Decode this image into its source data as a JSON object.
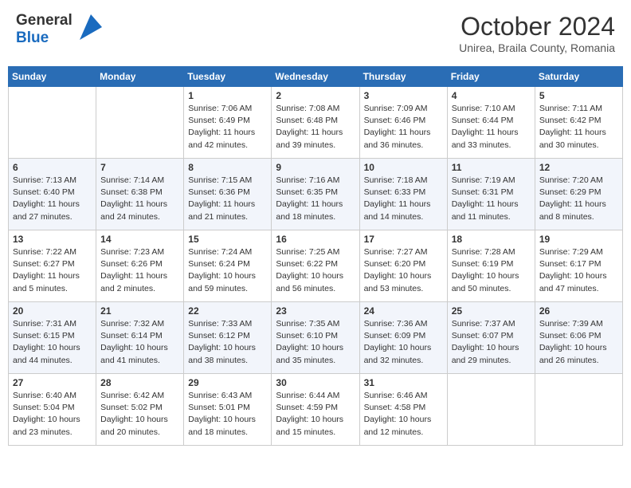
{
  "header": {
    "logo_general": "General",
    "logo_blue": "Blue",
    "month": "October 2024",
    "location": "Unirea, Braila County, Romania"
  },
  "days_of_week": [
    "Sunday",
    "Monday",
    "Tuesday",
    "Wednesday",
    "Thursday",
    "Friday",
    "Saturday"
  ],
  "weeks": [
    [
      {
        "day": "",
        "lines": []
      },
      {
        "day": "",
        "lines": []
      },
      {
        "day": "1",
        "lines": [
          "Sunrise: 7:06 AM",
          "Sunset: 6:49 PM",
          "Daylight: 11 hours",
          "and 42 minutes."
        ]
      },
      {
        "day": "2",
        "lines": [
          "Sunrise: 7:08 AM",
          "Sunset: 6:48 PM",
          "Daylight: 11 hours",
          "and 39 minutes."
        ]
      },
      {
        "day": "3",
        "lines": [
          "Sunrise: 7:09 AM",
          "Sunset: 6:46 PM",
          "Daylight: 11 hours",
          "and 36 minutes."
        ]
      },
      {
        "day": "4",
        "lines": [
          "Sunrise: 7:10 AM",
          "Sunset: 6:44 PM",
          "Daylight: 11 hours",
          "and 33 minutes."
        ]
      },
      {
        "day": "5",
        "lines": [
          "Sunrise: 7:11 AM",
          "Sunset: 6:42 PM",
          "Daylight: 11 hours",
          "and 30 minutes."
        ]
      }
    ],
    [
      {
        "day": "6",
        "lines": [
          "Sunrise: 7:13 AM",
          "Sunset: 6:40 PM",
          "Daylight: 11 hours",
          "and 27 minutes."
        ]
      },
      {
        "day": "7",
        "lines": [
          "Sunrise: 7:14 AM",
          "Sunset: 6:38 PM",
          "Daylight: 11 hours",
          "and 24 minutes."
        ]
      },
      {
        "day": "8",
        "lines": [
          "Sunrise: 7:15 AM",
          "Sunset: 6:36 PM",
          "Daylight: 11 hours",
          "and 21 minutes."
        ]
      },
      {
        "day": "9",
        "lines": [
          "Sunrise: 7:16 AM",
          "Sunset: 6:35 PM",
          "Daylight: 11 hours",
          "and 18 minutes."
        ]
      },
      {
        "day": "10",
        "lines": [
          "Sunrise: 7:18 AM",
          "Sunset: 6:33 PM",
          "Daylight: 11 hours",
          "and 14 minutes."
        ]
      },
      {
        "day": "11",
        "lines": [
          "Sunrise: 7:19 AM",
          "Sunset: 6:31 PM",
          "Daylight: 11 hours",
          "and 11 minutes."
        ]
      },
      {
        "day": "12",
        "lines": [
          "Sunrise: 7:20 AM",
          "Sunset: 6:29 PM",
          "Daylight: 11 hours",
          "and 8 minutes."
        ]
      }
    ],
    [
      {
        "day": "13",
        "lines": [
          "Sunrise: 7:22 AM",
          "Sunset: 6:27 PM",
          "Daylight: 11 hours",
          "and 5 minutes."
        ]
      },
      {
        "day": "14",
        "lines": [
          "Sunrise: 7:23 AM",
          "Sunset: 6:26 PM",
          "Daylight: 11 hours",
          "and 2 minutes."
        ]
      },
      {
        "day": "15",
        "lines": [
          "Sunrise: 7:24 AM",
          "Sunset: 6:24 PM",
          "Daylight: 10 hours",
          "and 59 minutes."
        ]
      },
      {
        "day": "16",
        "lines": [
          "Sunrise: 7:25 AM",
          "Sunset: 6:22 PM",
          "Daylight: 10 hours",
          "and 56 minutes."
        ]
      },
      {
        "day": "17",
        "lines": [
          "Sunrise: 7:27 AM",
          "Sunset: 6:20 PM",
          "Daylight: 10 hours",
          "and 53 minutes."
        ]
      },
      {
        "day": "18",
        "lines": [
          "Sunrise: 7:28 AM",
          "Sunset: 6:19 PM",
          "Daylight: 10 hours",
          "and 50 minutes."
        ]
      },
      {
        "day": "19",
        "lines": [
          "Sunrise: 7:29 AM",
          "Sunset: 6:17 PM",
          "Daylight: 10 hours",
          "and 47 minutes."
        ]
      }
    ],
    [
      {
        "day": "20",
        "lines": [
          "Sunrise: 7:31 AM",
          "Sunset: 6:15 PM",
          "Daylight: 10 hours",
          "and 44 minutes."
        ]
      },
      {
        "day": "21",
        "lines": [
          "Sunrise: 7:32 AM",
          "Sunset: 6:14 PM",
          "Daylight: 10 hours",
          "and 41 minutes."
        ]
      },
      {
        "day": "22",
        "lines": [
          "Sunrise: 7:33 AM",
          "Sunset: 6:12 PM",
          "Daylight: 10 hours",
          "and 38 minutes."
        ]
      },
      {
        "day": "23",
        "lines": [
          "Sunrise: 7:35 AM",
          "Sunset: 6:10 PM",
          "Daylight: 10 hours",
          "and 35 minutes."
        ]
      },
      {
        "day": "24",
        "lines": [
          "Sunrise: 7:36 AM",
          "Sunset: 6:09 PM",
          "Daylight: 10 hours",
          "and 32 minutes."
        ]
      },
      {
        "day": "25",
        "lines": [
          "Sunrise: 7:37 AM",
          "Sunset: 6:07 PM",
          "Daylight: 10 hours",
          "and 29 minutes."
        ]
      },
      {
        "day": "26",
        "lines": [
          "Sunrise: 7:39 AM",
          "Sunset: 6:06 PM",
          "Daylight: 10 hours",
          "and 26 minutes."
        ]
      }
    ],
    [
      {
        "day": "27",
        "lines": [
          "Sunrise: 6:40 AM",
          "Sunset: 5:04 PM",
          "Daylight: 10 hours",
          "and 23 minutes."
        ]
      },
      {
        "day": "28",
        "lines": [
          "Sunrise: 6:42 AM",
          "Sunset: 5:02 PM",
          "Daylight: 10 hours",
          "and 20 minutes."
        ]
      },
      {
        "day": "29",
        "lines": [
          "Sunrise: 6:43 AM",
          "Sunset: 5:01 PM",
          "Daylight: 10 hours",
          "and 18 minutes."
        ]
      },
      {
        "day": "30",
        "lines": [
          "Sunrise: 6:44 AM",
          "Sunset: 4:59 PM",
          "Daylight: 10 hours",
          "and 15 minutes."
        ]
      },
      {
        "day": "31",
        "lines": [
          "Sunrise: 6:46 AM",
          "Sunset: 4:58 PM",
          "Daylight: 10 hours",
          "and 12 minutes."
        ]
      },
      {
        "day": "",
        "lines": []
      },
      {
        "day": "",
        "lines": []
      }
    ]
  ]
}
